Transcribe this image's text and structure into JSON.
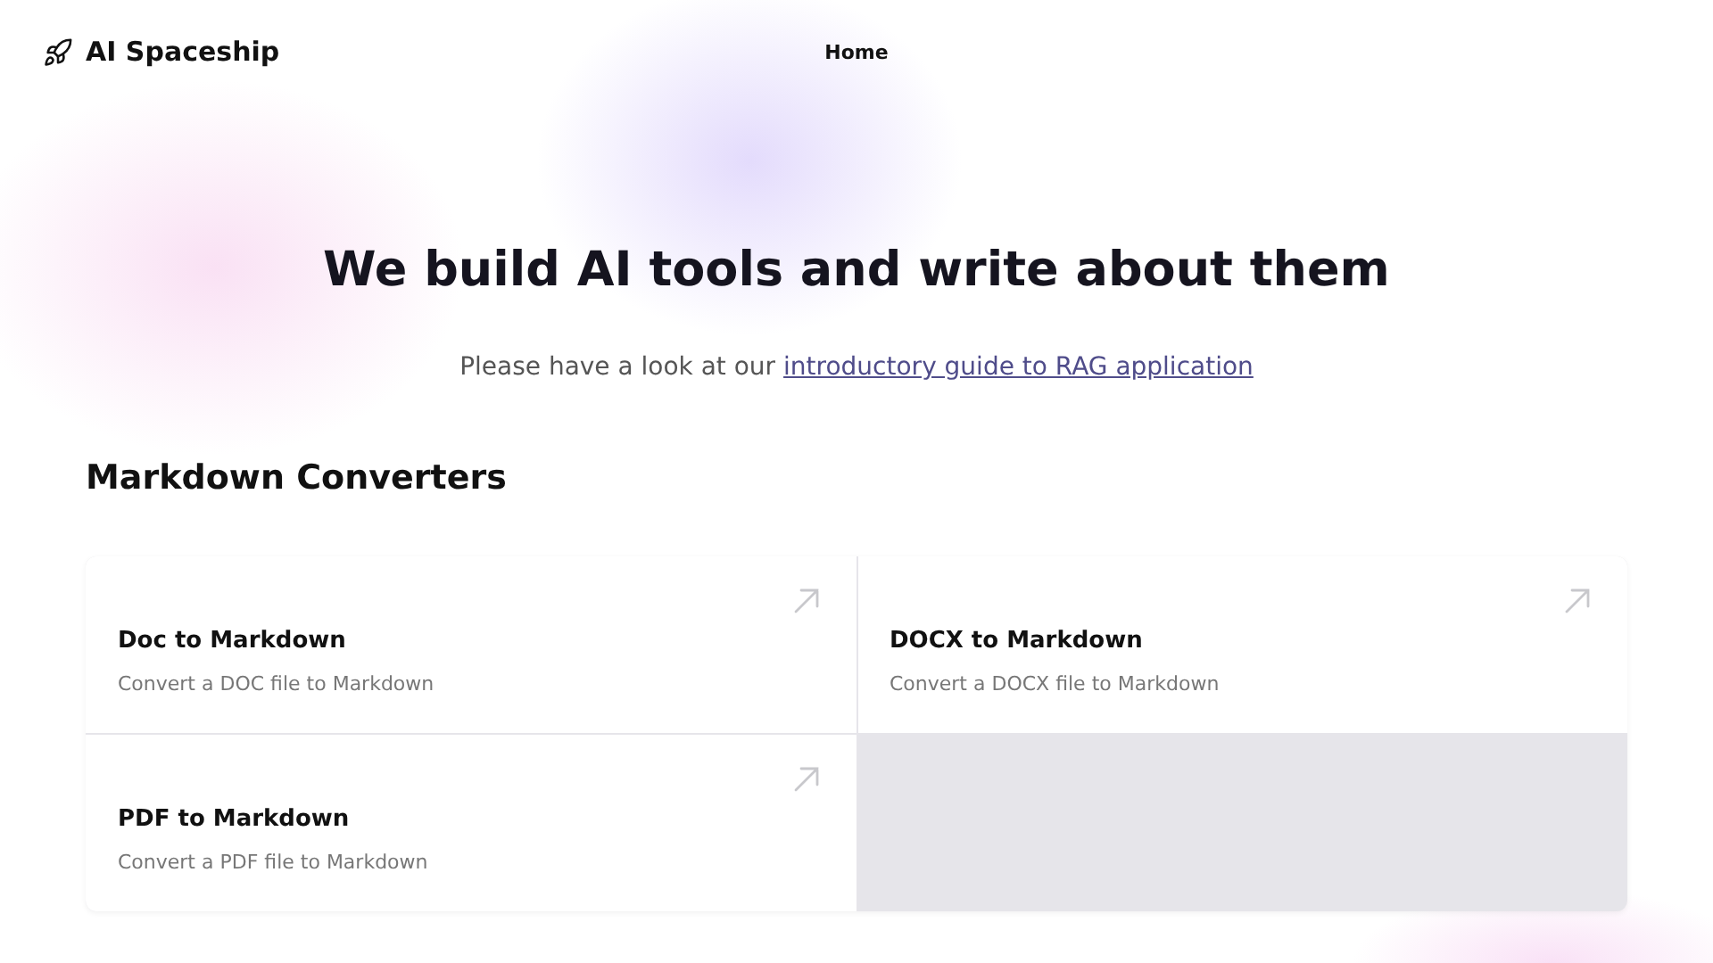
{
  "header": {
    "brand": "AI Spaceship",
    "nav": [
      {
        "label": "Home"
      }
    ]
  },
  "hero": {
    "title": "We build AI tools and write about them",
    "intro": "Please have a look at our",
    "link": "introductory guide to RAG application"
  },
  "section": {
    "title": "Markdown Converters",
    "cards": [
      {
        "title": "Doc to Markdown",
        "description": "Convert a DOC file to Markdown"
      },
      {
        "title": "DOCX to Markdown",
        "description": "Convert a DOCX file to Markdown"
      },
      {
        "title": "PDF to Markdown",
        "description": "Convert a PDF file to Markdown"
      }
    ]
  }
}
